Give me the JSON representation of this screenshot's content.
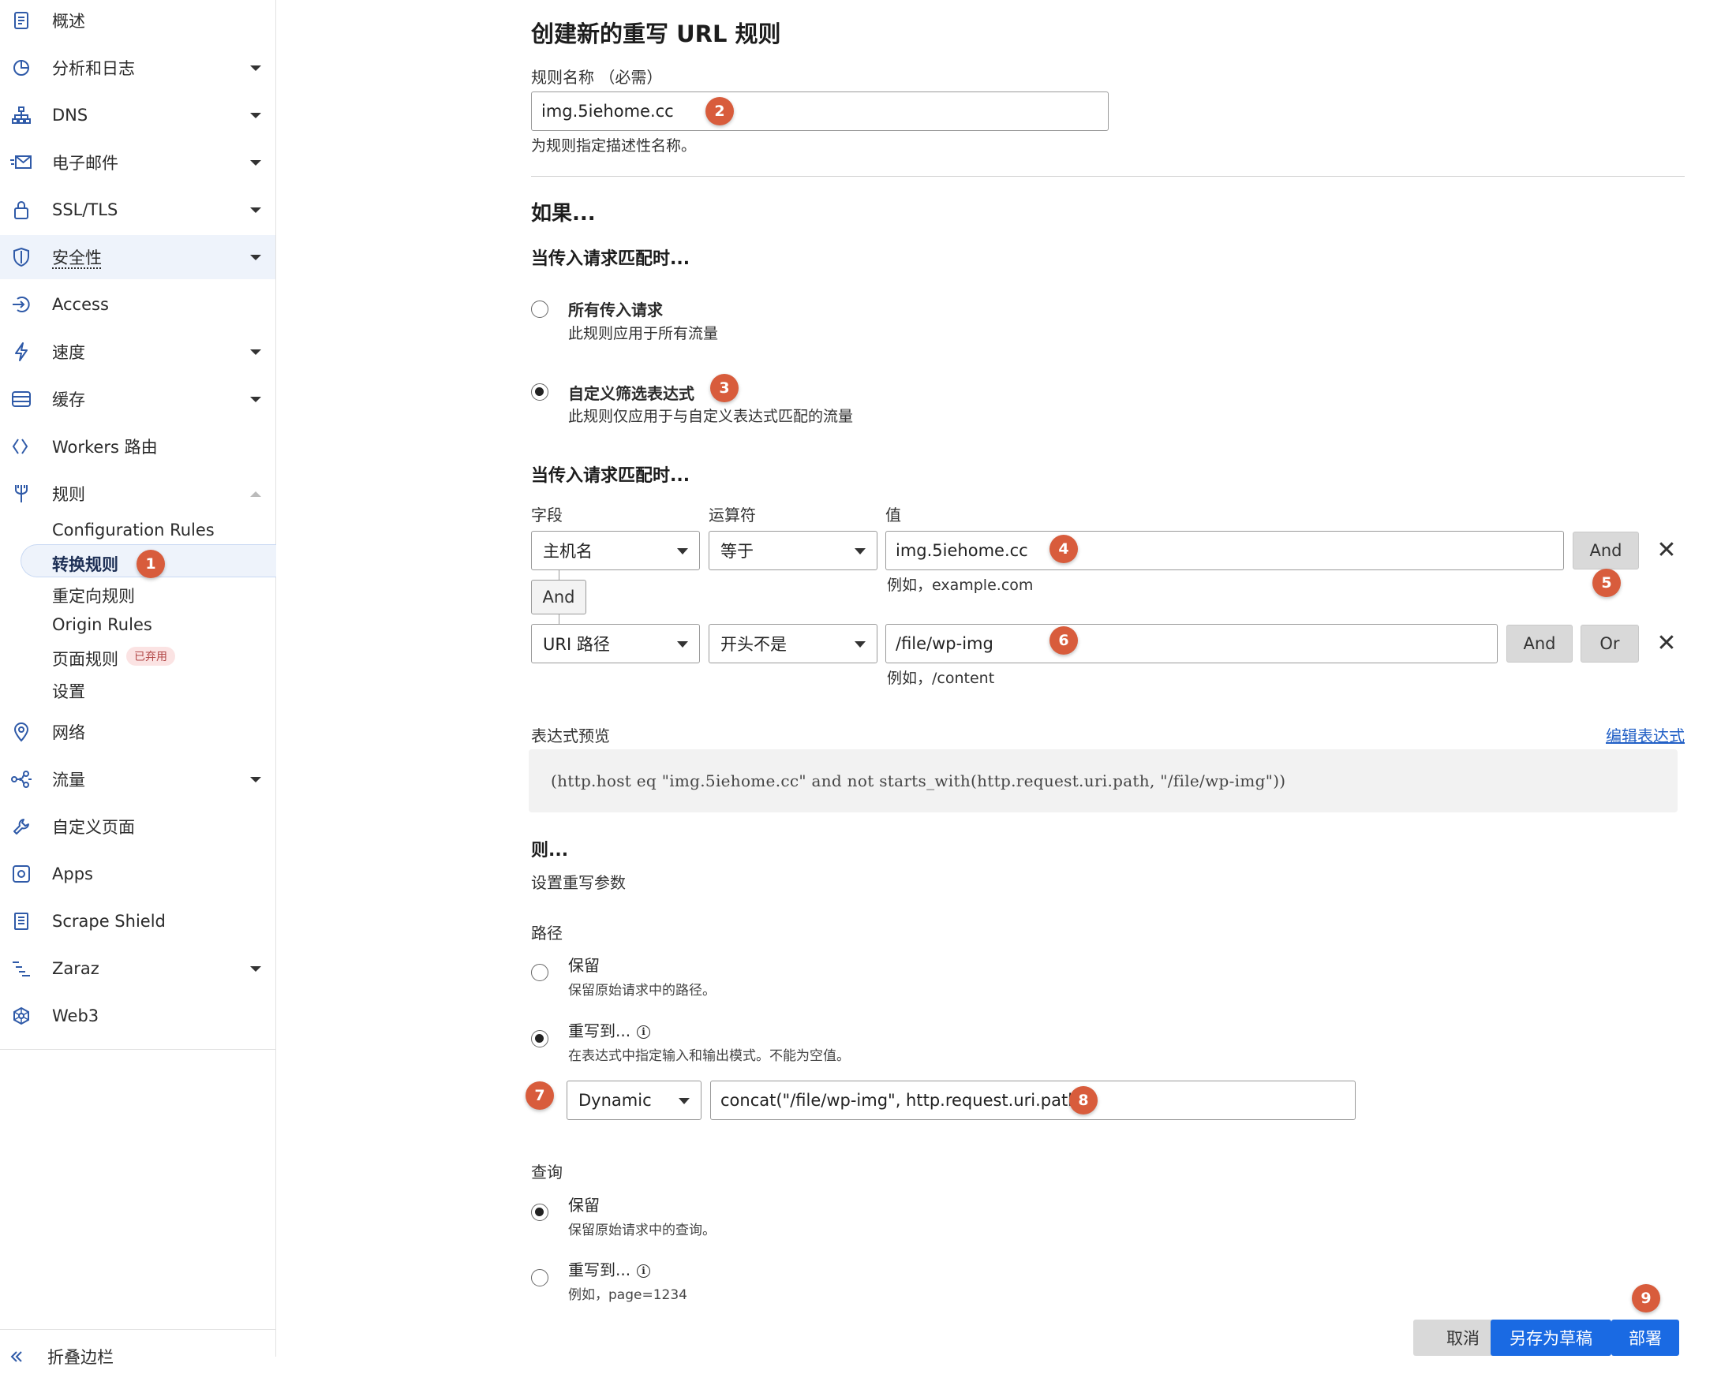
{
  "sidebar": {
    "items": [
      {
        "label": "概述",
        "icon": "document-icon",
        "caret": false
      },
      {
        "label": "分析和日志",
        "icon": "pie-chart-icon",
        "caret": true
      },
      {
        "label": "DNS",
        "icon": "network-tree-icon",
        "caret": true
      },
      {
        "label": "电子邮件",
        "icon": "email-icon",
        "caret": true
      },
      {
        "label": "SSL/TLS",
        "icon": "lock-icon",
        "caret": true
      },
      {
        "label": "安全性",
        "icon": "shield-icon",
        "caret": true
      },
      {
        "label": "Access",
        "icon": "access-arrow-icon",
        "caret": false
      },
      {
        "label": "速度",
        "icon": "lightning-icon",
        "caret": true
      },
      {
        "label": "缓存",
        "icon": "database-icon",
        "caret": true
      },
      {
        "label": "Workers 路由",
        "icon": "workers-icon",
        "caret": false
      },
      {
        "label": "规则",
        "icon": "fork-icon",
        "caret": "up"
      }
    ],
    "rules_sub": [
      "Configuration Rules",
      "转换规则",
      "重定向规则",
      "Origin Rules",
      "页面规则",
      "设置"
    ],
    "deprecated_badge": "已弃用",
    "items_after": [
      {
        "label": "网络",
        "icon": "location-pin-icon",
        "caret": false
      },
      {
        "label": "流量",
        "icon": "traffic-nodes-icon",
        "caret": true
      },
      {
        "label": "自定义页面",
        "icon": "wrench-icon",
        "caret": false
      },
      {
        "label": "Apps",
        "icon": "apps-icon",
        "caret": false
      },
      {
        "label": "Scrape Shield",
        "icon": "scrape-document-icon",
        "caret": false
      },
      {
        "label": "Zaraz",
        "icon": "zaraz-icon",
        "caret": true
      },
      {
        "label": "Web3",
        "icon": "web3-icon",
        "caret": false
      }
    ],
    "collapse_label": "折叠边栏"
  },
  "form": {
    "title": "创建新的重写 URL 规则",
    "rule_name_label": "规则名称 （必需）",
    "rule_name_value": "img.5iehome.cc",
    "rule_name_hint": "为规则指定描述性名称。",
    "if_heading": "如果...",
    "match_heading": "当传入请求匹配时...",
    "option_all_title": "所有传入请求",
    "option_all_desc": "此规则应用于所有流量",
    "option_custom_title": "自定义筛选表达式",
    "option_custom_desc": "此规则仅应用于与自定义表达式匹配的流量",
    "match_heading2": "当传入请求匹配时...",
    "col_field": "字段",
    "col_operator": "运算符",
    "col_value": "值",
    "row1": {
      "field": "主机名",
      "operator": "等于",
      "value": "img.5iehome.cc",
      "hint": "例如，example.com",
      "and": "And"
    },
    "connector_and": "And",
    "row2": {
      "field": "URI 路径",
      "operator": "开头不是",
      "value": "/file/wp-img",
      "hint": "例如，/content",
      "and": "And",
      "or": "Or"
    },
    "close_symbol": "✕",
    "expr_preview_label": "表达式预览",
    "edit_expr_link": "编辑表达式",
    "expression": "(http.host eq \"img.5iehome.cc\" and not starts_with(http.request.uri.path, \"/file/wp-img\"))",
    "then_heading": "则...",
    "then_desc": "设置重写参数",
    "path_label": "路径",
    "path_keep_title": "保留",
    "path_keep_desc": "保留原始请求中的路径。",
    "path_rewrite_title": "重写到...",
    "path_rewrite_desc": "在表达式中指定输入和输出模式。不能为空值。",
    "path_mode": "Dynamic",
    "path_expression": "concat(\"/file/wp-img\", http.request.uri.path)",
    "query_label": "查询",
    "query_keep_title": "保留",
    "query_keep_desc": "保留原始请求中的查询。",
    "query_rewrite_title": "重写到...",
    "query_rewrite_desc": "例如，page=1234",
    "info_symbol": "i"
  },
  "buttons": {
    "cancel": "取消",
    "save_draft": "另存为草稿",
    "deploy": "部署"
  },
  "badges": [
    "1",
    "2",
    "3",
    "4",
    "5",
    "6",
    "7",
    "8",
    "9"
  ],
  "colors": {
    "accent_blue": "#1a6ae3",
    "badge_red": "#d85c3c",
    "active_bg": "#eef3fb",
    "icon_blue": "#2f5aa8"
  }
}
